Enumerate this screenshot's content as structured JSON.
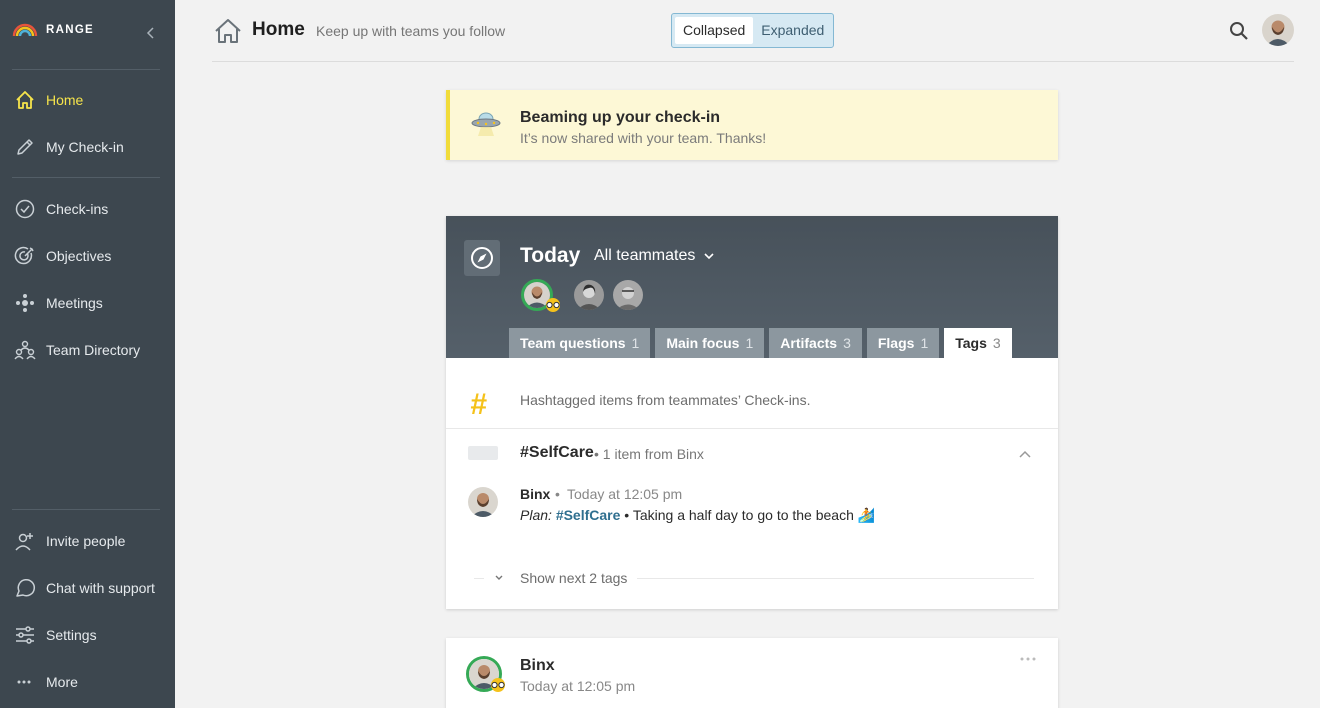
{
  "sidebar": {
    "brand": "RANGE",
    "items": [
      {
        "label": "Home",
        "icon": "home-icon",
        "active": true
      },
      {
        "label": "My Check-in",
        "icon": "pencil-icon"
      },
      {
        "label": "Check-ins",
        "icon": "check-circle-icon"
      },
      {
        "label": "Objectives",
        "icon": "target-icon"
      },
      {
        "label": "Meetings",
        "icon": "meetings-icon"
      },
      {
        "label": "Team Directory",
        "icon": "team-icon"
      }
    ],
    "bottom_items": [
      {
        "label": "Invite people",
        "icon": "add-user-icon"
      },
      {
        "label": "Chat with support",
        "icon": "chat-icon"
      },
      {
        "label": "Settings",
        "icon": "sliders-icon"
      },
      {
        "label": "More",
        "icon": "ellipsis-icon"
      }
    ]
  },
  "header": {
    "title": "Home",
    "subtitle": "Keep up with teams you follow",
    "view_toggle": [
      "Collapsed",
      "Expanded"
    ],
    "selected_view": "Collapsed"
  },
  "banner": {
    "title": "Beaming up your check-in",
    "text": "It’s now shared with your team. Thanks!"
  },
  "today_card": {
    "title": "Today",
    "team_filter": "All teammates",
    "tabs": [
      {
        "label": "Team questions",
        "count": "1"
      },
      {
        "label": "Main focus",
        "count": "1"
      },
      {
        "label": "Artifacts",
        "count": "3"
      },
      {
        "label": "Flags",
        "count": "1"
      },
      {
        "label": "Tags",
        "count": "3",
        "active": true
      }
    ],
    "tags_description": "Hashtagged items from teammates’ Check-ins.",
    "tag": {
      "name": "#SelfCare",
      "meta": "• 1 item from Binx"
    },
    "entry": {
      "author": "Binx",
      "separator": "•",
      "time": "Today at 12:05 pm",
      "plan_label": "Plan:",
      "tag": "#SelfCare",
      "text": "• Taking a half day to go to the beach 🏄"
    },
    "show_next": "Show next 2 tags"
  },
  "checkin_card": {
    "author": "Binx",
    "time": "Today at 12:05 pm"
  },
  "colors": {
    "sidebar_bg": "#3d474f",
    "active_nav": "#f6e44b",
    "banner_bg": "#fdf8d6",
    "banner_accent": "#f1dc3a",
    "header_bg": "#47515a",
    "tag_link": "#2f6f8f",
    "avatar_ring": "#35a956",
    "hash_icon": "#f5c21b"
  }
}
